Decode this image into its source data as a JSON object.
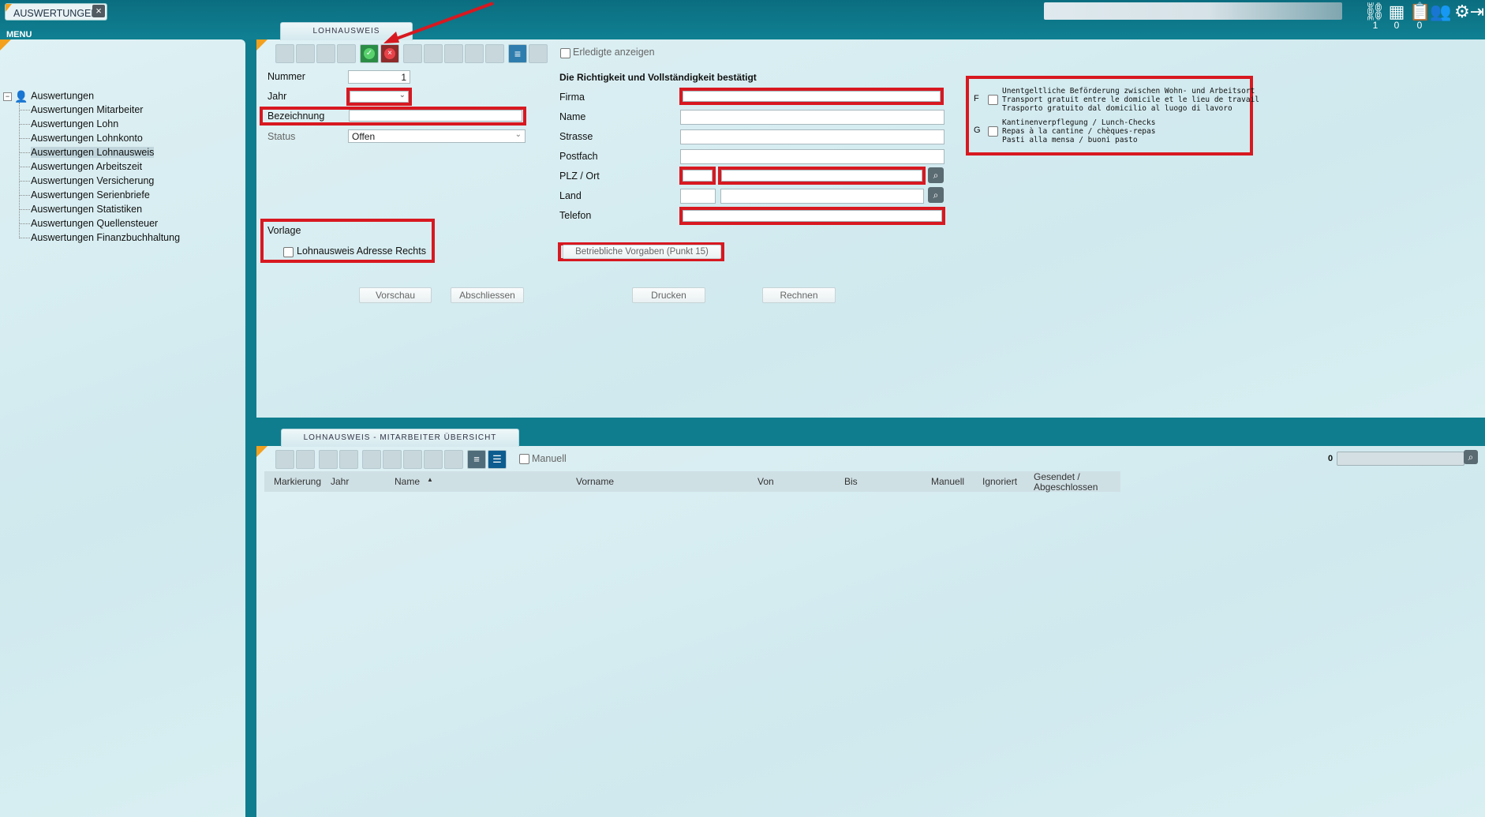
{
  "app_tab": {
    "label": "AUSWERTUNGEN",
    "close_icon": "close-icon"
  },
  "menu_label": "MENU",
  "header_counts": [
    "1",
    "0",
    "0"
  ],
  "tree": {
    "root": "Auswertungen",
    "items": [
      "Auswertungen Mitarbeiter",
      "Auswertungen Lohn",
      "Auswertungen Lohnkonto",
      "Auswertungen Lohnausweis",
      "Auswertungen Arbeitszeit",
      "Auswertungen Versicherung",
      "Auswertungen Serienbriefe",
      "Auswertungen Statistiken",
      "Auswertungen Quellensteuer",
      "Auswertungen Finanzbuchhaltung"
    ],
    "selected": "Auswertungen Lohnausweis"
  },
  "top_panel": {
    "tab_title": "LOHNAUSWEIS",
    "show_done_label": "Erledigte anzeigen",
    "form": {
      "nummer_label": "Nummer",
      "nummer_value": "1",
      "jahr_label": "Jahr",
      "jahr_value": "",
      "bezeichnung_label": "Bezeichnung",
      "bezeichnung_value": "",
      "status_label": "Status",
      "status_value": "Offen"
    },
    "vorlage": {
      "title": "Vorlage",
      "checkbox_label": "Lohnausweis Adresse Rechts"
    },
    "confirm": {
      "heading": "Die Richtigkeit und Vollständigkeit bestätigt",
      "firma_label": "Firma",
      "name_label": "Name",
      "strasse_label": "Strasse",
      "postfach_label": "Postfach",
      "plz_ort_label": "PLZ / Ort",
      "land_label": "Land",
      "telefon_label": "Telefon",
      "betrieb_button": "Betriebliche Vorgaben (Punkt 15)"
    },
    "options": {
      "f_letter": "F",
      "f_lines": [
        "Unentgeltliche Beförderung zwischen Wohn- und Arbeitsort",
        "Transport gratuit entre le domicile et le lieu de travail",
        "Trasporto gratuito dal domicilio al luogo di lavoro"
      ],
      "g_letter": "G",
      "g_lines": [
        "Kantinenverpflegung / Lunch-Checks",
        "Repas à la cantine / chèques-repas",
        "Pasti alla mensa / buoni pasto"
      ]
    },
    "buttons": {
      "vorschau": "Vorschau",
      "abschliessen": "Abschliessen",
      "drucken": "Drucken",
      "rechnen": "Rechnen"
    }
  },
  "bottom_panel": {
    "tab_title": "LOHNAUSWEIS - MITARBEITER ÜBERSICHT",
    "manuell_label": "Manuell",
    "count": "0",
    "columns": [
      "Markierung",
      "Jahr",
      "Name",
      "Vorname",
      "Von",
      "Bis",
      "Manuell",
      "Ignoriert",
      "Gesendet /",
      "Abgeschlossen"
    ],
    "sort_indicator": "▲"
  },
  "colors": {
    "accent_red": "#d81820",
    "teal": "#0f7d8e",
    "orange": "#f2a01e"
  }
}
